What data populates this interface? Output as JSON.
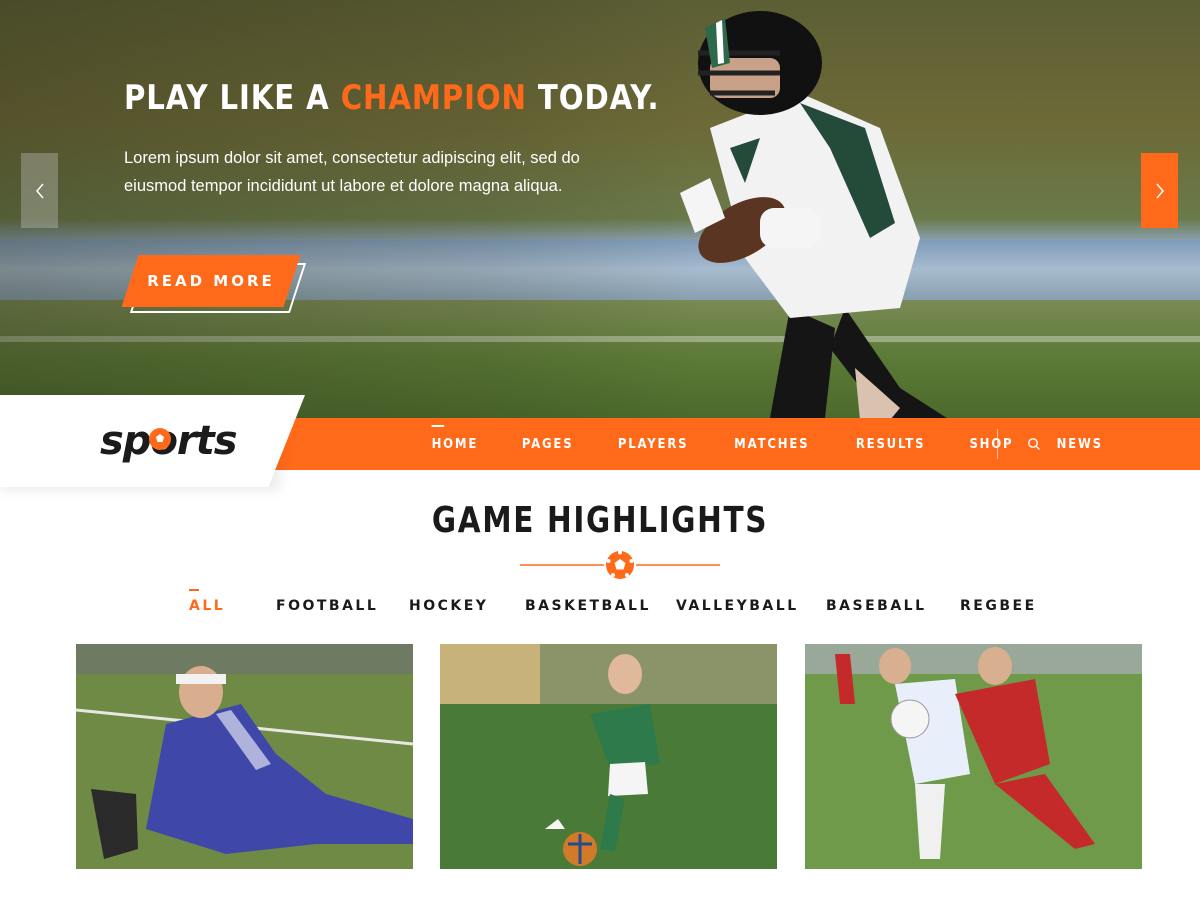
{
  "hero": {
    "title_prefix": "PLAY LIKE A ",
    "title_accent": "CHAMPION",
    "title_suffix": " TODAY.",
    "text": "Lorem ipsum dolor sit amet, consectetur adipiscing elit, sed do eiusmod tempor incididunt ut labore et dolore magna aliqua.",
    "button_label": "READ  MORE",
    "prev_icon": "chevron-left-icon",
    "next_icon": "chevron-right-icon"
  },
  "brand": {
    "logo_text": "sports",
    "logo_icon": "soccer-ball-icon"
  },
  "nav": {
    "items": [
      {
        "label": "HOME",
        "active": true
      },
      {
        "label": "PAGES"
      },
      {
        "label": "PLAYERS"
      },
      {
        "label": "MATCHES"
      },
      {
        "label": "RESULTS"
      },
      {
        "label": "SHOP"
      },
      {
        "label": "NEWS"
      }
    ],
    "search_icon": "search-icon"
  },
  "highlights": {
    "title": "GAME HIGHLIGHTS",
    "filters": [
      "ALL",
      "FOOTBALL",
      "HOCKEY",
      "BASKETBALL",
      "VALLEYBALL",
      "BASEBALL",
      "REGBEE"
    ],
    "active_filter": "ALL"
  },
  "colors": {
    "accent": "#ff6a1a",
    "dark": "#1a1a1a",
    "white": "#ffffff"
  }
}
